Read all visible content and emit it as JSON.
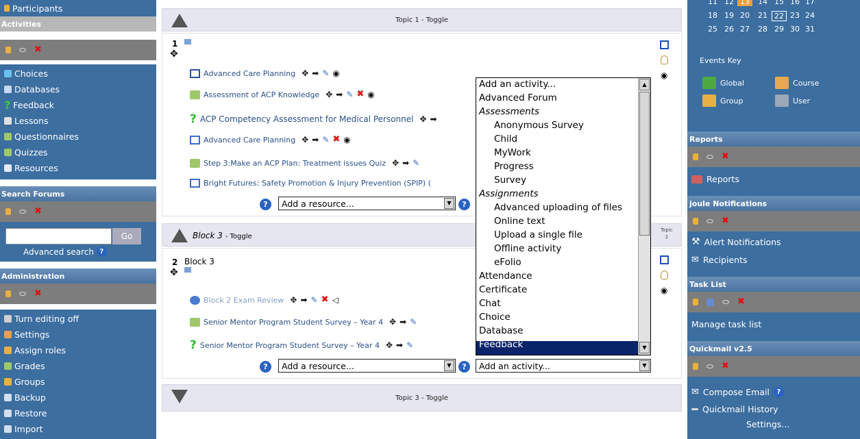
{
  "left": {
    "participants": "Participants",
    "activities": {
      "title": "Activities",
      "items": [
        "Choices",
        "Databases",
        "Feedback",
        "Lessons",
        "Questionnaires",
        "Quizzes",
        "Resources"
      ]
    },
    "search": {
      "title": "Search Forums",
      "input_value": "",
      "go_label": "Go",
      "advanced": "Advanced search"
    },
    "admin": {
      "title": "Administration",
      "items": [
        "Turn editing off",
        "Settings",
        "Assign roles",
        "Grades",
        "Groups",
        "Backup",
        "Restore",
        "Import"
      ]
    }
  },
  "main": {
    "topic1_title": "Topic 1 - Toggle",
    "section1_num": "1",
    "section1_activities": [
      "Advanced Care Planning",
      "Assessment of ACP Knowledge",
      "ACP Competency Assessment for Medical Personnel",
      "Advanced Care Planning",
      "Step 3:Make an ACP Plan: Treatment issues Quiz",
      "Bright Futures: Safety Promotion & Injury Prevention (SPIP) ("
    ],
    "add_resource": "Add a resource...",
    "add_activity": "Add an activity...",
    "block3_title": "Block 3",
    "block3_toggle": "- Toggle",
    "topic_side_label": "Topic",
    "topic_side_num": "2",
    "section2_num": "2",
    "section2_name": "Block 3",
    "section2_activities": [
      "Block 2 Exam Review",
      "Senior Mentor Program Student Survey – Year 4",
      "Senior Mentor Program Student Survey – Year 4"
    ],
    "topic3_title": "Topic 3 - Toggle"
  },
  "dropdown": {
    "items": [
      {
        "label": "Add an activity...",
        "kind": "item"
      },
      {
        "label": "Advanced Forum",
        "kind": "item"
      },
      {
        "label": "Assessments",
        "kind": "group"
      },
      {
        "label": "Anonymous Survey",
        "kind": "sub"
      },
      {
        "label": "Child",
        "kind": "sub"
      },
      {
        "label": "MyWork",
        "kind": "sub"
      },
      {
        "label": "Progress",
        "kind": "sub"
      },
      {
        "label": "Survey",
        "kind": "sub"
      },
      {
        "label": "Assignments",
        "kind": "group"
      },
      {
        "label": "Advanced uploading of files",
        "kind": "sub"
      },
      {
        "label": "Online text",
        "kind": "sub"
      },
      {
        "label": "Upload a single file",
        "kind": "sub"
      },
      {
        "label": "Offline activity",
        "kind": "sub"
      },
      {
        "label": "eFolio",
        "kind": "sub"
      },
      {
        "label": "Attendance",
        "kind": "item"
      },
      {
        "label": "Certificate",
        "kind": "item"
      },
      {
        "label": "Chat",
        "kind": "item"
      },
      {
        "label": "Choice",
        "kind": "item"
      },
      {
        "label": "Database",
        "kind": "item"
      },
      {
        "label": "Feedback",
        "kind": "selected"
      }
    ]
  },
  "right": {
    "calendar_rows": [
      [
        "11",
        "12",
        "13",
        "14",
        "15",
        "16",
        "17"
      ],
      [
        "18",
        "19",
        "20",
        "21",
        "22",
        "23",
        "24"
      ],
      [
        "25",
        "26",
        "27",
        "28",
        "29",
        "30",
        "31"
      ]
    ],
    "today": "13",
    "events_key": "Events Key",
    "events": [
      "Global",
      "Course",
      "Group",
      "User"
    ],
    "reports_title": "Reports",
    "reports_link": "Reports",
    "joule_title": "joule Notifications",
    "alert": "Alert Notifications",
    "recipients": "Recipients",
    "task_title": "Task List",
    "manage": "Manage task list",
    "quickmail_title": "Quickmail v2.5",
    "compose": "Compose Email",
    "history": "Quickmail History",
    "settings": "Settings..."
  },
  "colors": {
    "block_blue": "#3c6ea0",
    "header_grey": "#7d7d7d",
    "selected": "#0a246a",
    "delete_red": "#e01010"
  }
}
